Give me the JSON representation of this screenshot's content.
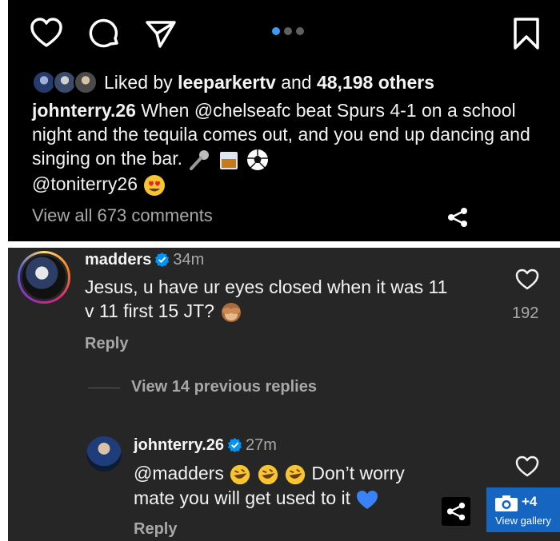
{
  "post": {
    "icons": [
      "heart-icon",
      "comment-icon",
      "send-icon",
      "bookmark-icon"
    ],
    "carousel": {
      "count": 3,
      "active": 1
    },
    "likes": {
      "prefix": "Liked by ",
      "user": "leeparkertv",
      "middle": " and ",
      "count": "48,198 others"
    },
    "caption": {
      "user": "johnterry.26",
      "text": " When @chelseafc beat Spurs 4-1 on a school night and the tequila comes out, and you end up dancing and singing on the bar. ",
      "mention": "@toniterry26"
    },
    "view_comments": "View all 673 comments"
  },
  "comment": {
    "user": "madders",
    "time": "34m",
    "line1": "Jesus, u have ur eyes closed when it was 11",
    "line2": "v 11 first 15 JT?",
    "likes": "192",
    "reply": "Reply"
  },
  "previous_replies": "View 14 previous replies",
  "reply": {
    "user": "johnterry.26",
    "time": "27m",
    "mention": "@madders",
    "text1": " Don’t worry",
    "line2": "mate you will get used to it",
    "reply": "Reply"
  },
  "gallery": {
    "count": "+4",
    "label": "View gallery"
  },
  "colors": {
    "accent": "#3d9bf2",
    "verified": "#0095f6",
    "gallery": "#1665c0",
    "heart_emoji": "#3b82f6"
  }
}
